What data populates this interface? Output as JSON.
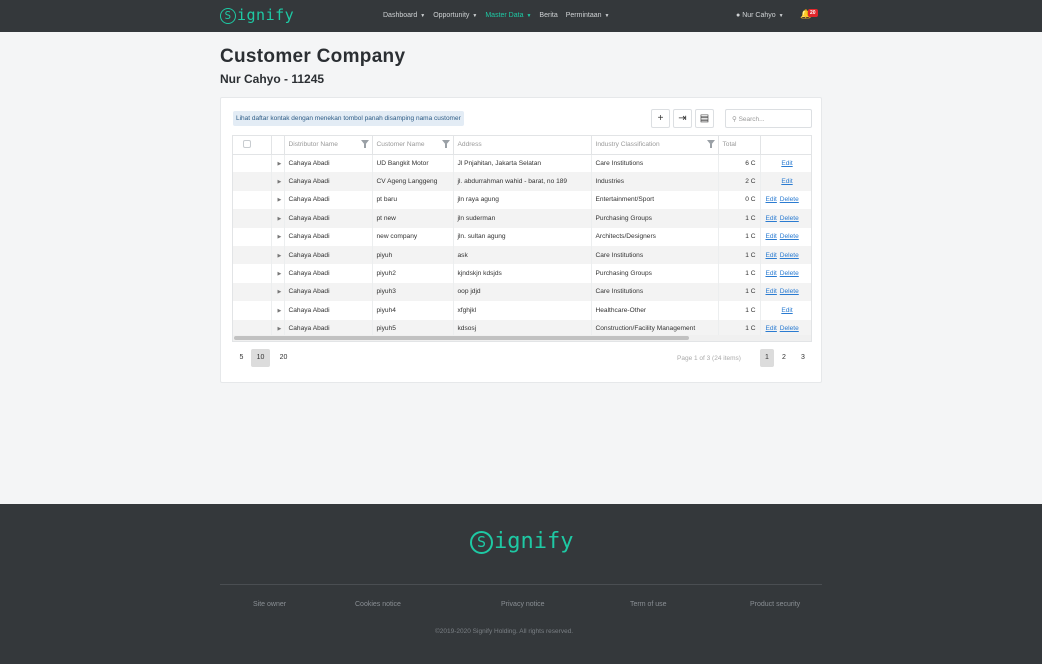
{
  "nav": {
    "brand": "ignify",
    "brand_initial": "S",
    "menu": [
      {
        "label": "Dashboard",
        "active": false,
        "dropdown": true
      },
      {
        "label": "Opportunity",
        "active": false,
        "dropdown": true
      },
      {
        "label": "Master Data",
        "active": true,
        "dropdown": true
      },
      {
        "label": "Berita",
        "active": false,
        "dropdown": false
      },
      {
        "label": "Permintaan",
        "active": false,
        "dropdown": true
      }
    ],
    "user": "Nur Cahyo",
    "badge": "20",
    "accent_color": "#1ec9a4"
  },
  "page": {
    "title": "Customer Company",
    "subtitle": "Nur Cahyo - 11245"
  },
  "toolbar": {
    "hint": "Lihat daftar kontak dengan menekan tombol panah disamping nama customer",
    "search_placeholder": "Search..."
  },
  "table": {
    "columns": [
      "Distributor Name",
      "Customer Name",
      "Address",
      "Industry Classification",
      "Total"
    ],
    "rows": [
      {
        "distributor": "Cahaya Abadi",
        "customer": "UD Bangkit Motor",
        "address": "Jl Pnjahitan, Jakarta Selatan",
        "industry": "Care Institutions",
        "total": "6 C",
        "edit": "Edit",
        "delete": ""
      },
      {
        "distributor": "Cahaya Abadi",
        "customer": "CV Ageng Langgeng",
        "address": "jl. abdurrahman wahid - barat, no 189",
        "industry": "Industries",
        "total": "2 C",
        "edit": "Edit",
        "delete": ""
      },
      {
        "distributor": "Cahaya Abadi",
        "customer": "pt baru",
        "address": "jln raya agung",
        "industry": "Entertainment/Sport",
        "total": "0 C",
        "edit": "Edit",
        "delete": "Delete"
      },
      {
        "distributor": "Cahaya Abadi",
        "customer": "pt new",
        "address": "jln suderman",
        "industry": "Purchasing Groups",
        "total": "1 C",
        "edit": "Edit",
        "delete": "Delete"
      },
      {
        "distributor": "Cahaya Abadi",
        "customer": "new company",
        "address": "jln. sultan agung",
        "industry": "Architects/Designers",
        "total": "1 C",
        "edit": "Edit",
        "delete": "Delete"
      },
      {
        "distributor": "Cahaya Abadi",
        "customer": "piyuh",
        "address": "ask",
        "industry": "Care Institutions",
        "total": "1 C",
        "edit": "Edit",
        "delete": "Delete"
      },
      {
        "distributor": "Cahaya Abadi",
        "customer": "piyuh2",
        "address": "kjndskjn kdsjds",
        "industry": "Purchasing Groups",
        "total": "1 C",
        "edit": "Edit",
        "delete": "Delete"
      },
      {
        "distributor": "Cahaya Abadi",
        "customer": "piyuh3",
        "address": "oop jdjd",
        "industry": "Care Institutions",
        "total": "1 C",
        "edit": "Edit",
        "delete": "Delete"
      },
      {
        "distributor": "Cahaya Abadi",
        "customer": "piyuh4",
        "address": "xfghjkl",
        "industry": "Healthcare-Other",
        "total": "1 C",
        "edit": "Edit",
        "delete": ""
      },
      {
        "distributor": "Cahaya Abadi",
        "customer": "piyuh5",
        "address": "kdsosj",
        "industry": "Construction/Facility Management",
        "total": "1 C",
        "edit": "Edit",
        "delete": "Delete"
      }
    ]
  },
  "pager": {
    "sizes": [
      "5",
      "10",
      "20"
    ],
    "selected_size": "10",
    "info": "Page 1 of 3 (24 items)",
    "pages": [
      "1",
      "2",
      "3"
    ],
    "current_page": "1"
  },
  "footer": {
    "brand": "ignify",
    "brand_initial": "S",
    "links": [
      "Site owner",
      "Cookies notice",
      "Privacy notice",
      "Term of use",
      "Product security"
    ],
    "copyright": "©2019-2020 Signify Holding. All rights reserved."
  }
}
